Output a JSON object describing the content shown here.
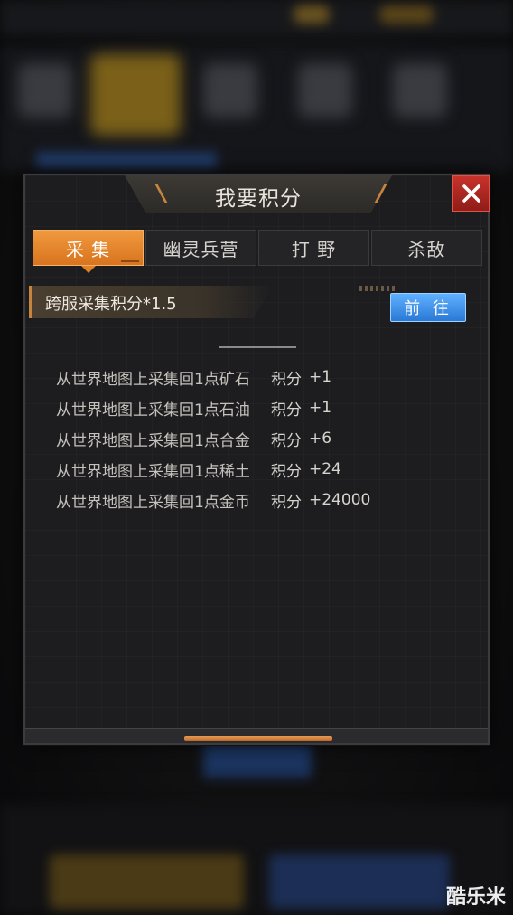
{
  "dialog": {
    "title": "我要积分",
    "close_icon": "close-icon"
  },
  "tabs": [
    {
      "label": "采 集",
      "active": true
    },
    {
      "label": "幽灵兵营",
      "active": false
    },
    {
      "label": "打 野",
      "active": false
    },
    {
      "label": "杀敌",
      "active": false
    }
  ],
  "bonus": {
    "text": "跨服采集积分*1.5",
    "go_label": "前 往"
  },
  "rules": [
    {
      "desc": "从世界地图上采集回1点矿石",
      "points_label": "积分",
      "points": "+1"
    },
    {
      "desc": "从世界地图上采集回1点石油",
      "points_label": "积分",
      "points": "+1"
    },
    {
      "desc": "从世界地图上采集回1点合金",
      "points_label": "积分",
      "points": "+6"
    },
    {
      "desc": "从世界地图上采集回1点稀土",
      "points_label": "积分",
      "points": "+24"
    },
    {
      "desc": "从世界地图上采集回1点金币",
      "points_label": "积分",
      "points": "+24000"
    }
  ],
  "watermark": "酷乐米",
  "colors": {
    "accent_orange": "#e18126",
    "close_red": "#b0261f",
    "go_blue": "#2a79d6",
    "panel_bg": "#1d1d20"
  }
}
